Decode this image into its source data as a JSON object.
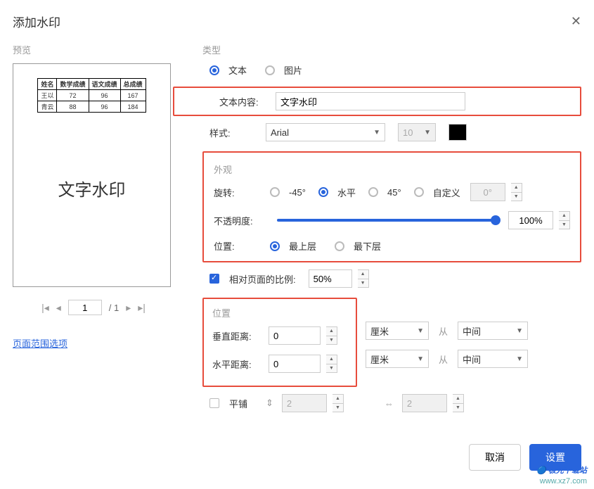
{
  "dialog": {
    "title": "添加水印"
  },
  "preview": {
    "label": "预览",
    "watermark_text": "文字水印",
    "table": {
      "headers": [
        "姓名",
        "数学成绩",
        "语文成绩",
        "总成绩"
      ],
      "rows": [
        [
          "王以",
          "72",
          "96",
          "167"
        ],
        [
          "青云",
          "88",
          "96",
          "184"
        ]
      ]
    },
    "pager": {
      "current": "1",
      "total": "/ 1"
    },
    "range_link": "页面范围选项"
  },
  "type_section": {
    "label": "类型",
    "option_text": "文本",
    "option_image": "图片",
    "content_label": "文本内容:",
    "content_value": "文字水印",
    "style_label": "样式:",
    "font_value": "Arial",
    "size_value": "10"
  },
  "appearance": {
    "label": "外观",
    "rotate_label": "旋转:",
    "rotate_neg45": "-45°",
    "rotate_0": "水平",
    "rotate_45": "45°",
    "rotate_custom": "自定义",
    "rotate_value": "0°",
    "opacity_label": "不透明度:",
    "opacity_value": "100%",
    "layer_label": "位置:",
    "layer_top": "最上层",
    "layer_bottom": "最下层",
    "scale_label": "相对页面的比例:",
    "scale_value": "50%"
  },
  "position": {
    "label": "位置",
    "vdist_label": "垂直距离:",
    "vdist_value": "0",
    "hdist_label": "水平距离:",
    "hdist_value": "0",
    "unit_value": "厘米",
    "from_label": "从",
    "ref_value": "中间",
    "tile_label": "平铺",
    "tile_v": "2",
    "tile_h": "2"
  },
  "footer": {
    "cancel": "取消",
    "confirm": "设置"
  },
  "branding": {
    "line1": "极光下载站",
    "line2": "www.xz7.com"
  }
}
